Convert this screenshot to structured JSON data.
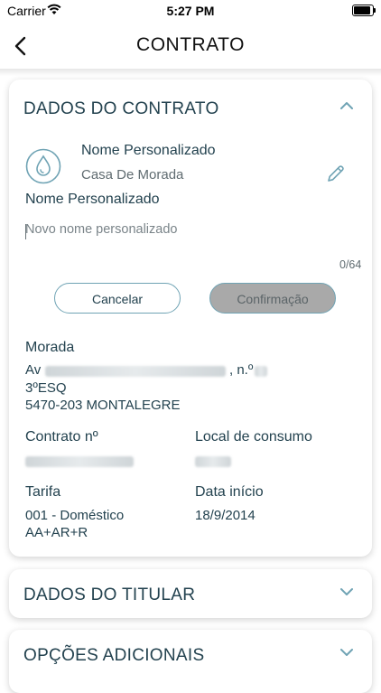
{
  "status": {
    "carrier": "Carrier",
    "time": "5:27 PM"
  },
  "nav": {
    "title": "CONTRATO"
  },
  "contract_card": {
    "title": "DADOS DO CONTRATO",
    "custom_name_header": "Nome Personalizado",
    "custom_name_value": "Casa De Morada",
    "input_label": "Nome Personalizado",
    "input_placeholder": "Novo nome personalizado",
    "counter": "0/64",
    "cancel_label": "Cancelar",
    "confirm_label": "Confirmação",
    "address_label": "Morada",
    "address_line1_prefix": "Av",
    "address_line1_suffix": ", n.º",
    "address_line2": "3ºESQ",
    "address_line3": "5470-203 MONTALEGRE",
    "contract_no_label": "Contrato nº",
    "consumption_label": "Local de consumo",
    "tariff_label": "Tarifa",
    "tariff_value_line1": "001 - Doméstico",
    "tariff_value_line2": "AA+AR+R",
    "start_label": "Data início",
    "start_value": "18/9/2014"
  },
  "holder_card": {
    "title": "DADOS DO TITULAR"
  },
  "extra_card": {
    "title": "OPÇÕES ADICIONAIS"
  }
}
